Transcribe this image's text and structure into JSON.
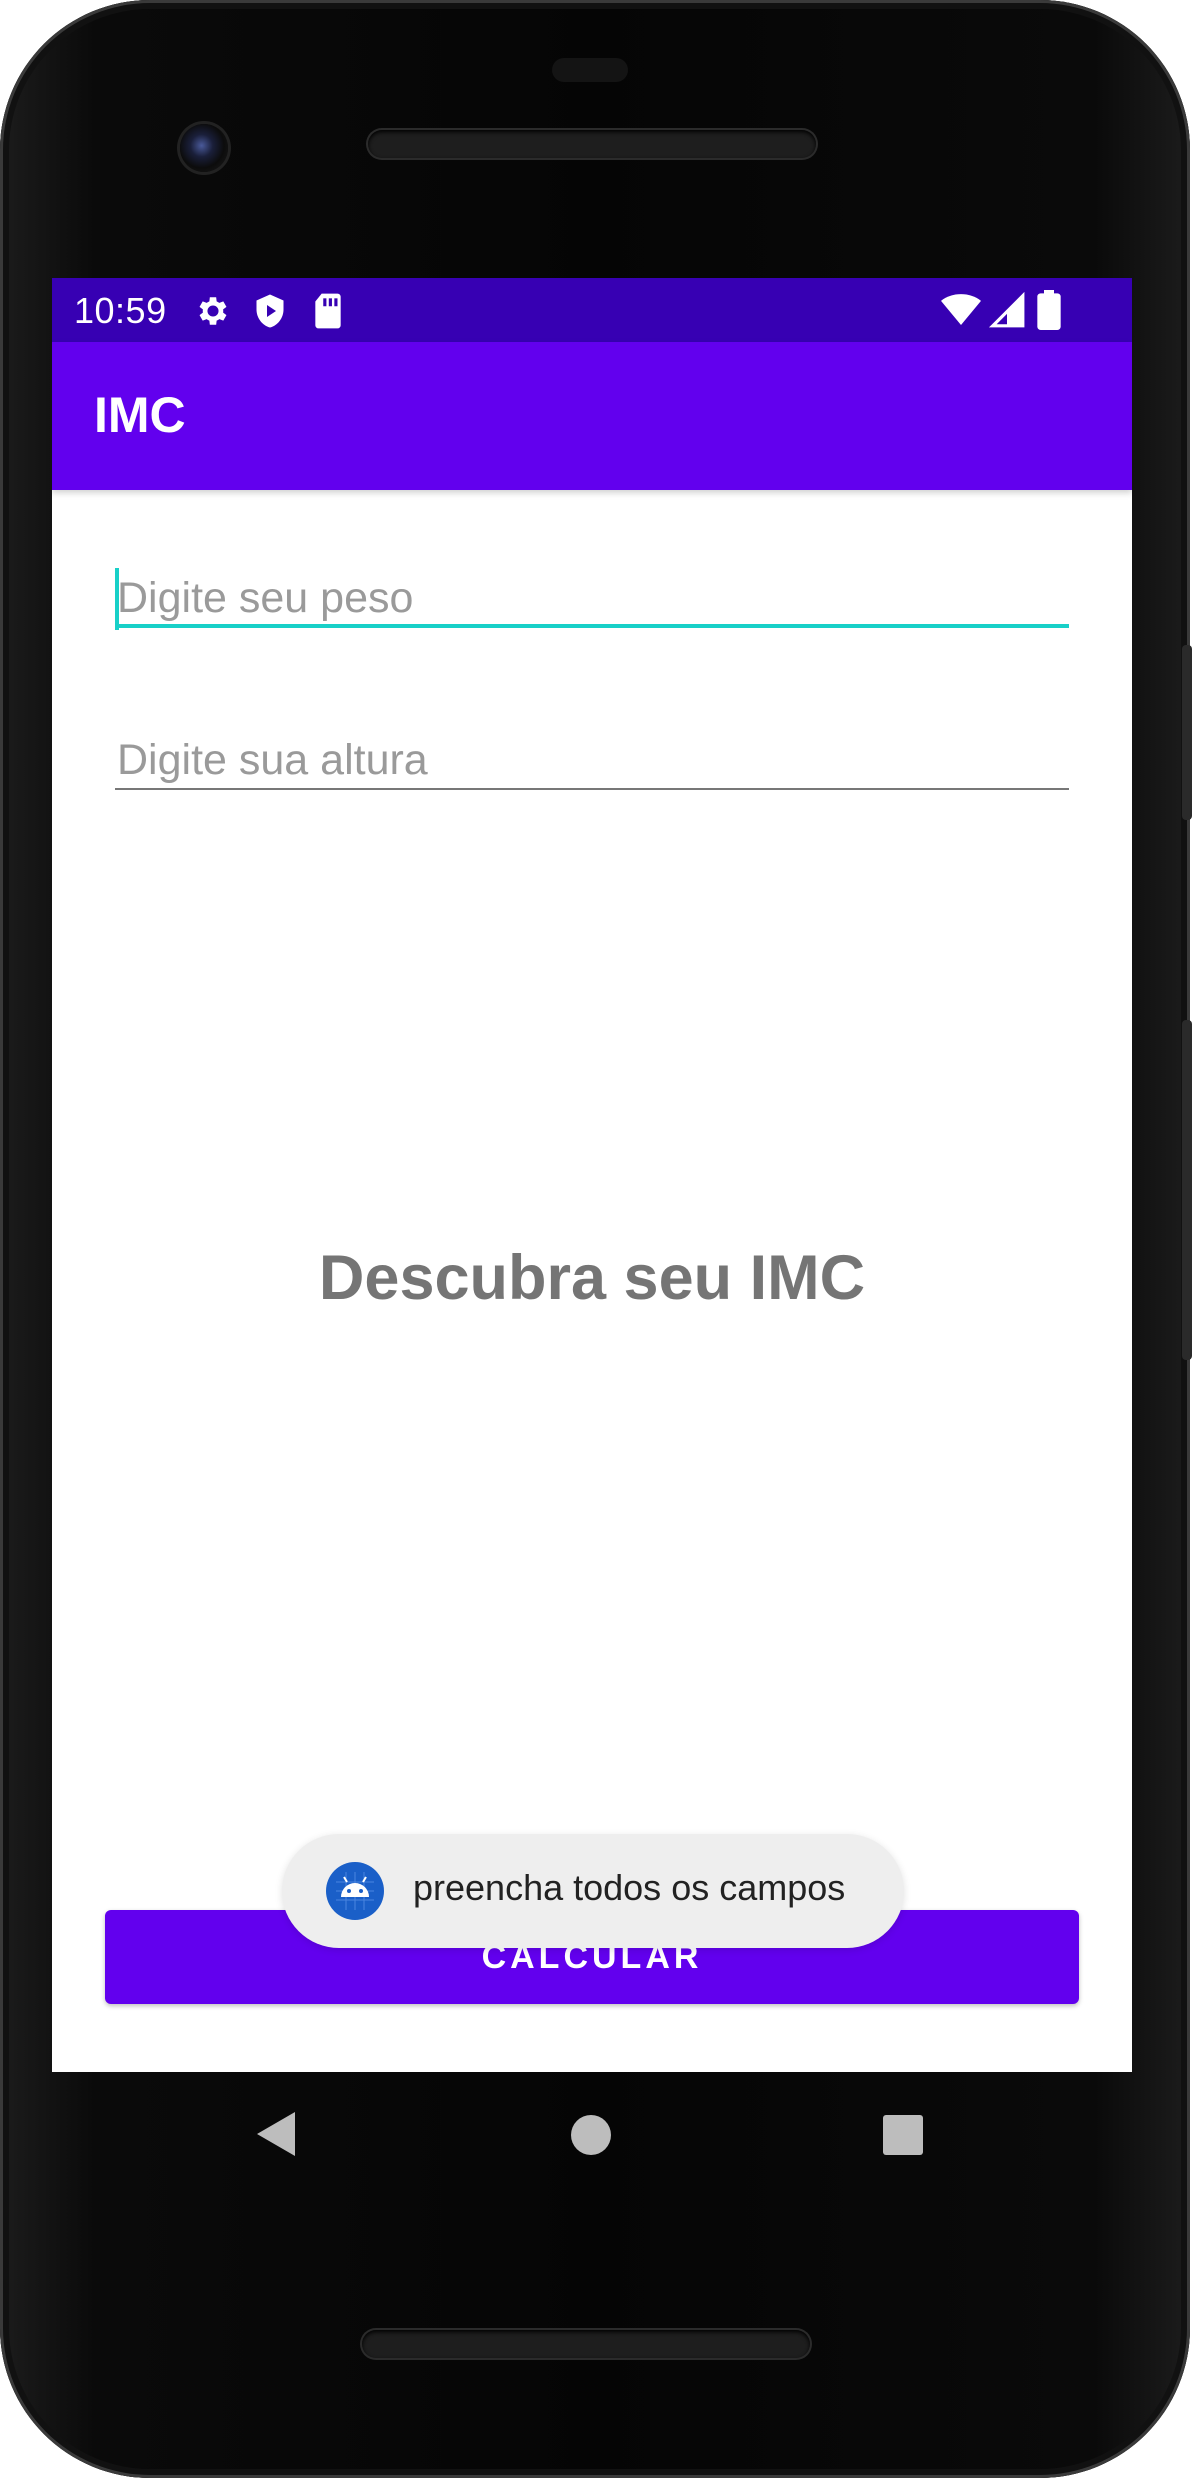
{
  "status_bar": {
    "time": "10:59",
    "icons": [
      "gear-icon",
      "shield-icon",
      "sd-card-icon",
      "wifi-icon",
      "cell-signal-icon",
      "battery-icon"
    ],
    "background": "#3700b3"
  },
  "app_bar": {
    "title": "IMC",
    "background": "#6200ee"
  },
  "form": {
    "weight_placeholder": "Digite seu peso",
    "weight_value": "",
    "height_placeholder": "Digite sua altura",
    "height_value": "",
    "focus_color": "#18d0c8"
  },
  "result_text": "Descubra seu IMC",
  "calculate_button": {
    "label": "CALCULAR",
    "color": "#6200ee"
  },
  "toast": {
    "message": "preencha todos os campos",
    "icon": "android-icon"
  },
  "nav_bar": {
    "icons": [
      "back-icon",
      "home-icon",
      "recents-icon"
    ]
  }
}
